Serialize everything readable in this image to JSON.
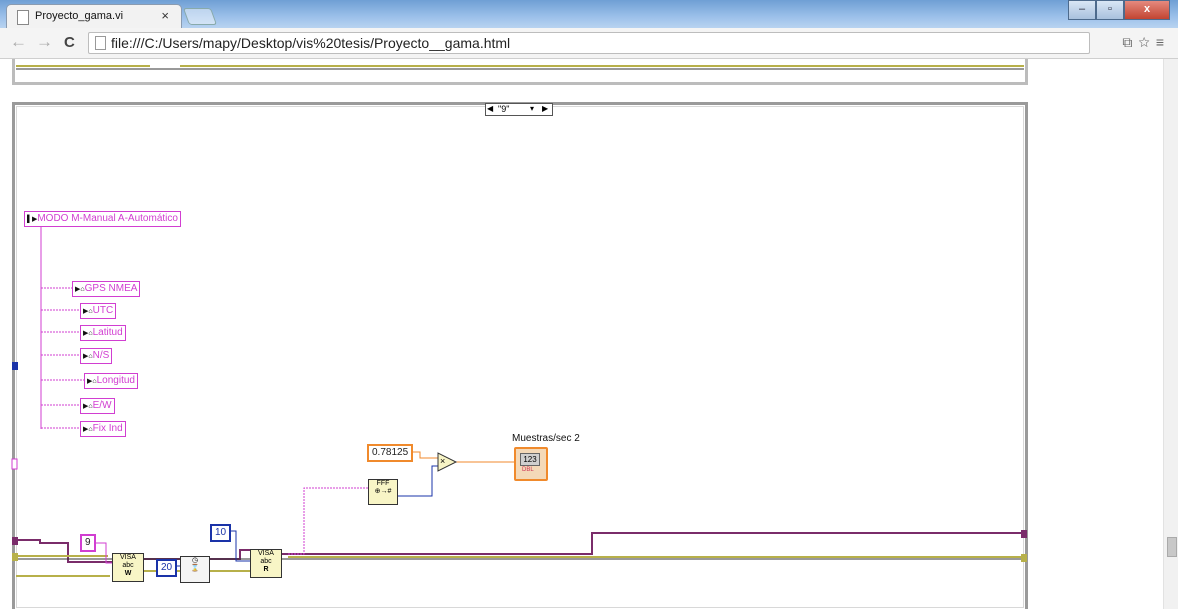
{
  "browser": {
    "tab_title": "Proyecto_gama.vi",
    "tab_close": "×",
    "url": "file:///C:/Users/mapy/Desktop/vis%20tesis/Proyecto__gama.html"
  },
  "diagram": {
    "case_selector": "\"9\"",
    "cluster_root_label": "MODO  M-Manual A-Automático",
    "cluster_items": [
      "GPS NMEA",
      "UTC",
      "Latitud",
      "N/S",
      "Longitud",
      "E/W",
      "Fix Ind"
    ],
    "const_9": "9",
    "const_20": "20",
    "const_10": "10",
    "const_078125": "0.78125",
    "indicator_label": "Muestras/sec 2",
    "indicator_value": "123",
    "indicator_type": "DBL",
    "visa_write_label": "VISA",
    "visa_read_label": "VISA",
    "multiply_symbol": "×"
  },
  "colors": {
    "string_wire": "#d13ed1",
    "numeric_blue": "#1a33a8",
    "numeric_orange": "#f08a2c",
    "error_wire": "#b7b04a",
    "visa_wire": "#7a2c6a"
  }
}
